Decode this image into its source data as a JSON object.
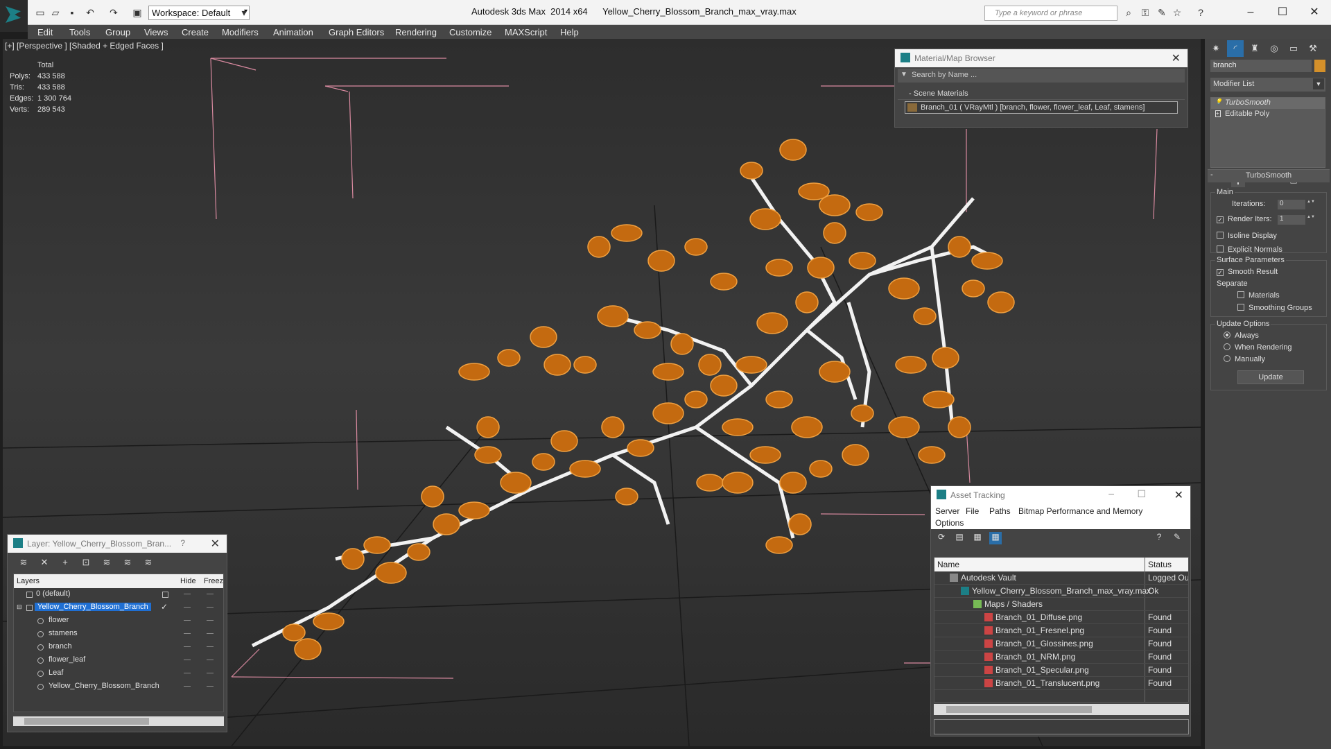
{
  "titlebar": {
    "workspace": "Workspace: Default",
    "app_title": "Autodesk 3ds Max  2014 x64      Yellow_Cherry_Blossom_Branch_max_vray.max",
    "search_placeholder": "Type a keyword or phrase"
  },
  "menu": [
    "Edit",
    "Tools",
    "Group",
    "Views",
    "Create",
    "Modifiers",
    "Animation",
    "Graph Editors",
    "Rendering",
    "Customize",
    "MAXScript",
    "Help"
  ],
  "viewport": {
    "label": "[+] [Perspective ] [Shaded + Edged Faces ]",
    "stats": {
      "header": "Total",
      "polys_label": "Polys:",
      "polys": "433 588",
      "tris_label": "Tris:",
      "tris": "433 588",
      "edges_label": "Edges:",
      "edges": "1 300 764",
      "verts_label": "Verts:",
      "verts": "289 543"
    }
  },
  "material_browser": {
    "title": "Material/Map Browser",
    "search_placeholder": "Search by Name ...",
    "section": "Scene Materials",
    "item": "Branch_01  ( VRayMtl )  [branch, flower, flower_leaf, Leaf, stamens]"
  },
  "command_panel": {
    "object_name": "branch",
    "object_color": "#d4902a",
    "modifier_list": "Modifier List",
    "stack": [
      "TurboSmooth",
      "Editable Poly"
    ],
    "rollout_title": "TurboSmooth",
    "main_label": "Main",
    "iterations_label": "Iterations:",
    "iterations": "0",
    "render_iters_label": "Render Iters:",
    "render_iters": "1",
    "isoline_label": "Isoline Display",
    "explicit_normals_label": "Explicit Normals",
    "surface_label": "Surface Parameters",
    "smooth_result_label": "Smooth Result",
    "separate_label": "Separate",
    "materials_label": "Materials",
    "smoothing_groups_label": "Smoothing Groups",
    "update_options_label": "Update Options",
    "always_label": "Always",
    "when_rendering_label": "When Rendering",
    "manually_label": "Manually",
    "update_button": "Update"
  },
  "layer_explorer": {
    "title": "Layer: Yellow_Cherry_Blossom_Bran...",
    "help": "?",
    "col_layers": "Layers",
    "col_hide": "Hide",
    "col_freeze": "Freez",
    "rows": [
      "0 (default)",
      "Yellow_Cherry_Blossom_Branch",
      "flower",
      "stamens",
      "branch",
      "flower_leaf",
      "Leaf",
      "Yellow_Cherry_Blossom_Branch"
    ]
  },
  "asset_tracking": {
    "title": "Asset Tracking",
    "menu": [
      "Server",
      "File",
      "Paths",
      "Bitmap Performance and Memory",
      "Options"
    ],
    "col_name": "Name",
    "col_status": "Status",
    "rows": [
      {
        "name": "Autodesk Vault",
        "status": "Logged Ou"
      },
      {
        "name": "Yellow_Cherry_Blossom_Branch_max_vray.max",
        "status": "Ok"
      },
      {
        "name": "Maps / Shaders",
        "status": ""
      },
      {
        "name": "Branch_01_Diffuse.png",
        "status": "Found"
      },
      {
        "name": "Branch_01_Fresnel.png",
        "status": "Found"
      },
      {
        "name": "Branch_01_Glossines.png",
        "status": "Found"
      },
      {
        "name": "Branch_01_NRM.png",
        "status": "Found"
      },
      {
        "name": "Branch_01_Specular.png",
        "status": "Found"
      },
      {
        "name": "Branch_01_Translucent.png",
        "status": "Found"
      }
    ]
  },
  "colors": {
    "flower": "#c46a10",
    "flower_edge": "#f0a040",
    "branch": "#f2f2f2",
    "grid_line": "#1a1a1a",
    "selection_bracket": "#d98aa0"
  }
}
